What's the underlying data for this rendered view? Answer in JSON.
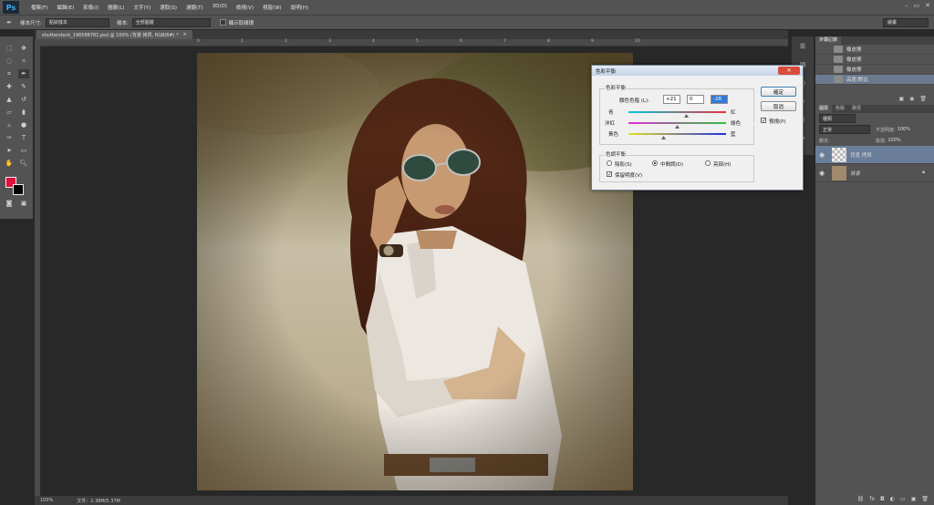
{
  "app": {
    "logo": "Ps"
  },
  "menu": [
    "檔案(F)",
    "編輯(E)",
    "影像(I)",
    "圖層(L)",
    "文字(Y)",
    "選取(S)",
    "濾鏡(T)",
    "3D(D)",
    "檢視(V)",
    "視窗(W)",
    "說明(H)"
  ],
  "window_controls": [
    "–",
    "▭",
    "✕"
  ],
  "options_bar": {
    "sample_size_label": "樣本尺寸:",
    "sample_size_value": "點狀樣本",
    "sample_label": "樣本:",
    "sample_value": "全部圖層",
    "show_ring_label": "顯示取樣環",
    "workspace": "繪畫"
  },
  "document": {
    "tab_title": "shutterstock_196588781.psd @ 100% (背景 拷貝, RGB/8#) *",
    "tab_close": "×",
    "zoom": "100%",
    "file_info": "文件：2.38M/5.37M"
  },
  "ruler_ticks": [
    "0",
    "1",
    "2",
    "3",
    "4",
    "5",
    "6",
    "7",
    "8",
    "9",
    "10"
  ],
  "colors": {
    "foreground": "#e0103a",
    "background": "#000000",
    "accent": "#6a7e9a"
  },
  "history_panel": {
    "tabs": [
      "步驟記錄"
    ],
    "items": [
      {
        "label": "橡皮擦",
        "selected": false
      },
      {
        "label": "橡皮擦",
        "selected": false
      },
      {
        "label": "橡皮擦",
        "selected": false
      },
      {
        "label": "高度/對比",
        "selected": true
      }
    ]
  },
  "layers_panel": {
    "tabs": [
      "圖層",
      "色版",
      "路徑"
    ],
    "kind_label": "種類",
    "blend_mode": "正常",
    "opacity_label": "不透明度:",
    "opacity_value": "100%",
    "lock_label": "鎖定:",
    "fill_label": "填滿:",
    "fill_value": "100%",
    "layers": [
      {
        "name": "背景 拷貝",
        "selected": true
      },
      {
        "name": "背景",
        "selected": false
      }
    ]
  },
  "dialog": {
    "title": "色彩平衡",
    "close_label": "✕",
    "color_balance_group": "色彩平衡",
    "color_levels_label": "顏色色階 (L):",
    "levels": [
      "+21",
      "0",
      "-28"
    ],
    "sliders": [
      {
        "left": "青",
        "right": "紅",
        "value": 21
      },
      {
        "left": "洋紅",
        "right": "綠色",
        "value": 0
      },
      {
        "left": "黃色",
        "right": "藍",
        "value": -28
      }
    ],
    "tone_balance_group": "色調平衡",
    "tones": [
      {
        "label": "陰影(S)",
        "selected": false
      },
      {
        "label": "中間調(D)",
        "selected": true
      },
      {
        "label": "亮部(H)",
        "selected": false
      }
    ],
    "preserve_luminosity_label": "保留明度(V)",
    "preserve_luminosity_checked": true,
    "ok_label": "確定",
    "cancel_label": "取消",
    "preview_label": "預視(P)",
    "preview_checked": true
  }
}
